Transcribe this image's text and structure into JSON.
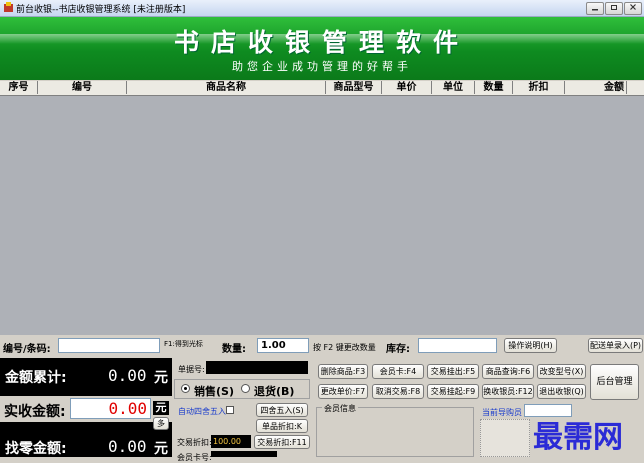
{
  "window": {
    "title": "前台收银--书店收银管理系统 [未注册版本]"
  },
  "banner": {
    "title": "书店收银管理软件",
    "slogan": "助您企业成功管理的好帮手"
  },
  "table": {
    "headers": [
      "序号",
      "编号",
      "商品名称",
      "商品型号",
      "单价",
      "单位",
      "数量",
      "折扣",
      "金额"
    ]
  },
  "entry": {
    "code_label": "编号/条码:",
    "hint_f1": "F1:得到光标",
    "qty_label": "数量:",
    "qty_value": "1.00",
    "qty_hint": "按 F2 键更改数量",
    "stock_label": "库存:",
    "help_button": "操作说明(H)",
    "delivery_button": "配送单录入(P)"
  },
  "totals": {
    "sum_label": "金额累计:",
    "sum_value": "0.00",
    "paid_label": "实收金额:",
    "paid_value": "0.00",
    "change_label": "找零金额:",
    "change_value": "0.00",
    "currency": "元",
    "more_button": "多"
  },
  "middle": {
    "receipt_label": "单据号:",
    "sale_label": "销售(S)",
    "return_label": "退货(B)",
    "auto_round_label": "自动四舍五入",
    "round_button": "四舍五入(S)",
    "item_discount_button": "单品折扣:K",
    "trade_discount_label": "交易折扣:",
    "trade_discount_value": "100.00",
    "trade_discount_button": "交易折扣:F11",
    "member_card_label": "会员卡号:"
  },
  "functions": {
    "buttons": [
      "删除商品:F3",
      "会员卡:F4",
      "交易挂出:F5",
      "商品查询:F6",
      "改变型号(X)",
      "更改单价:F7",
      "取消交易:F8",
      "交易挂起:F9",
      "换收银员:F12",
      "退出收银(Q)"
    ],
    "backend_button": "后台管理",
    "member_info_label": "会员信息",
    "current_guide_label": "当前导购员"
  },
  "watermark": "最需网",
  "colors": {
    "banner_green": "#0e8b20",
    "amount_red": "#e00000",
    "link_blue": "#1a3ccc"
  }
}
